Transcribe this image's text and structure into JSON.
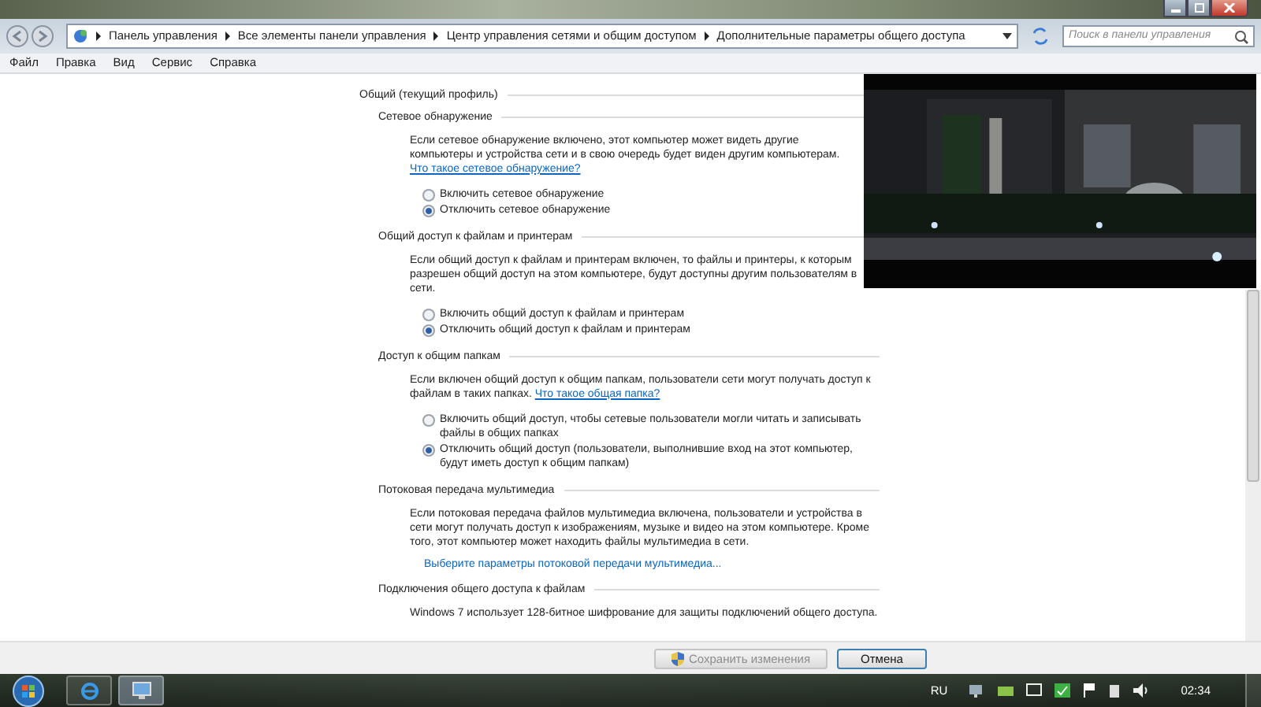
{
  "address_bar": {
    "breadcrumbs": [
      "Панель управления",
      "Все элементы панели управления",
      "Центр управления сетями и общим доступом",
      "Дополнительные параметры общего доступа"
    ]
  },
  "search": {
    "placeholder": "Поиск в панели управления"
  },
  "menu": [
    "Файл",
    "Правка",
    "Вид",
    "Сервис",
    "Справка"
  ],
  "profile": {
    "title": "Общий (текущий профиль)"
  },
  "sections": [
    {
      "title": "Сетевое обнаружение",
      "description": "Если сетевое обнаружение включено, этот компьютер может видеть другие компьютеры и устройства сети и в свою очередь будет виден другим компьютерам.",
      "help_link": "Что такое сетевое обнаружение?",
      "options": [
        {
          "label": "Включить сетевое обнаружение",
          "selected": false
        },
        {
          "label": "Отключить сетевое обнаружение",
          "selected": true
        }
      ]
    },
    {
      "title": "Общий доступ к файлам и принтерам",
      "description": "Если общий доступ к файлам и принтерам включен, то файлы и принтеры, к которым разрешен общий доступ на этом компьютере, будут доступны другим пользователям в сети.",
      "options": [
        {
          "label": "Включить общий доступ к файлам и принтерам",
          "selected": false
        },
        {
          "label": "Отключить общий доступ к файлам и принтерам",
          "selected": true
        }
      ]
    },
    {
      "title": "Доступ к общим папкам",
      "description": "Если включен общий доступ к общим папкам, пользователи сети могут получать доступ к файлам в таких папках.",
      "help_link": "Что такое общая папка?",
      "options": [
        {
          "label": "Включить общий доступ, чтобы сетевые пользователи могли читать и записывать файлы в общих папках",
          "selected": false
        },
        {
          "label": "Отключить общий доступ (пользователи, выполнившие вход на этот компьютер, будут иметь доступ к общим папкам)",
          "selected": true
        }
      ]
    },
    {
      "title": "Потоковая передача мультимедиа",
      "description": "Если потоковая передача файлов мультимедиа включена, пользователи и устройства в сети могут получать доступ к изображениям, музыке и видео на этом компьютере. Кроме того, этот компьютер может находить файлы мультимедиа в сети.",
      "action_link": "Выберите параметры потоковой передачи мультимедиа..."
    },
    {
      "title": "Подключения общего доступа к файлам",
      "description": "Windows 7 использует 128-битное шифрование для защиты подключений общего доступа."
    }
  ],
  "buttons": [
    {
      "label": "Сохранить изменения",
      "disabled": true,
      "shield": true
    },
    {
      "label": "Отмена",
      "disabled": false,
      "shield": false
    }
  ],
  "taskbar": {
    "language": "RU",
    "time": "02:34"
  }
}
